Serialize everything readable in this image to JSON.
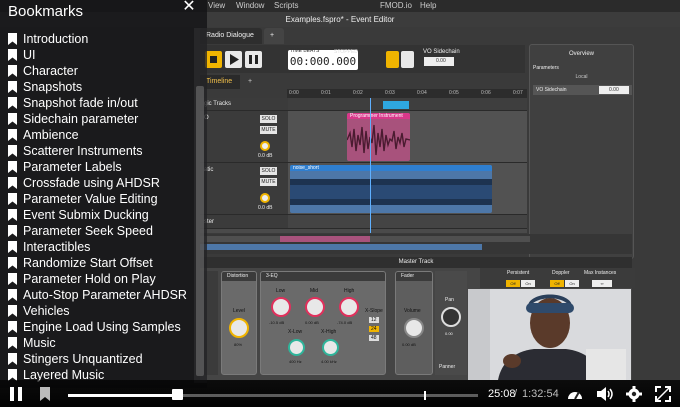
{
  "app": {
    "menu": [
      "View",
      "Window",
      "Scripts",
      "FMOD.io",
      "Help"
    ],
    "window_title": "Examples.fspro* - Event Editor",
    "editor_tabs": [
      "Radio Dialogue",
      "+"
    ],
    "timeline_tabs": [
      "Timeline",
      "+"
    ],
    "time_label": "TIME  BEATS",
    "stopped_label": "STOPPED",
    "time_display": "00:000.000",
    "vo_sidechain_label": "VO Sidechain",
    "vo_sidechain_value": "0.00",
    "ruler_ticks": [
      "0:00",
      "0:01",
      "0:02",
      "0:03",
      "0:04",
      "0:05",
      "0:06",
      "0:07"
    ],
    "tracks": {
      "logic_label": "gic Tracks",
      "track1_label": "O",
      "track2_label": "atic",
      "master_label": "ster",
      "solo": "SOLO",
      "mute": "MUTE",
      "db1": "0.0 dB",
      "db2": "0.0 dB",
      "instrument1": "Programmer Instrument",
      "instrument2": "noise_short"
    },
    "overview": {
      "title": "Overview",
      "section": "Parameters",
      "sub": "Local",
      "param_name": "VO Sidechain",
      "param_value": "0.00"
    },
    "master": {
      "title": "Master Track",
      "distortion": "Distortion",
      "distortion_knob": "Level",
      "distortion_value": "80%",
      "eq": "3-EQ",
      "eq_low": "Low",
      "eq_mid": "Mid",
      "eq_high": "High",
      "eq_low_val": "-10.5 dB",
      "eq_mid_val": "0.00 dB",
      "eq_high_val": "-74.0 dB",
      "eq_xlow": "X-Low",
      "eq_xhigh": "X-High",
      "eq_xlow_val": "400 Hz",
      "eq_xhigh_val": "4.00 kHz",
      "eq_xslope": "X-Slope",
      "slopes": [
        "12",
        "24",
        "48"
      ],
      "fader": "Fader",
      "volume": "Volume",
      "volume_val": "0.00 dB",
      "pan": "Pan",
      "pan_val": "0.00",
      "panner": "Panner",
      "persistent": "Persistent",
      "doppler": "Doppler",
      "max_instances": "Max Instances",
      "off": "Off",
      "on": "On",
      "max_inst_val": "∞"
    }
  },
  "bookmarks": {
    "title": "Bookmarks",
    "items": [
      "Introduction",
      "UI",
      "Character",
      "Snapshots",
      "Snapshot fade in/out",
      "Sidechain parameter",
      "Ambience",
      "Scatterer Instruments",
      "Parameter Labels",
      "Crossfade using AHDSR",
      "Parameter Value Editing",
      "Event Submix Ducking",
      "Parameter Seek Speed",
      "Interactibles",
      "Randomize Start Offset",
      "Parameter Hold on Play",
      "Auto-Stop Parameter AHDSR",
      "Vehicles",
      "Engine Load Using Samples",
      "Music",
      "Stingers Unquantized",
      "Layered Music"
    ]
  },
  "player": {
    "current_time": "25:08",
    "separator": "/",
    "total_time": "1:32:54",
    "progress": 0.267
  }
}
